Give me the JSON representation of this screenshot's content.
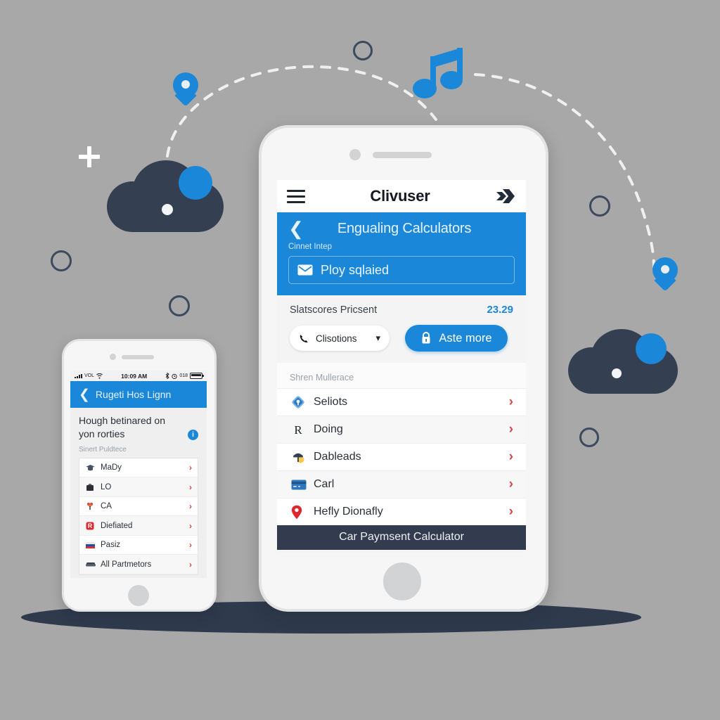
{
  "scene": {
    "background_color": "#a8a8a8",
    "accent_blue": "#1a87d8",
    "dark_navy": "#343f52",
    "chevron_red": "#d84545",
    "decorations": [
      {
        "name": "music-note-icon",
        "color": "#1a87d8"
      },
      {
        "name": "cloud-icon-left",
        "color": "#343f52"
      },
      {
        "name": "cloud-icon-right",
        "color": "#343f52"
      },
      {
        "name": "map-pin-icon-left",
        "color": "#1a87d8"
      },
      {
        "name": "map-pin-icon-right",
        "color": "#1a87d8"
      },
      {
        "name": "plus-icon",
        "color": "#ffffff"
      },
      {
        "name": "dashed-arc-left",
        "color": "#f0f0f0"
      },
      {
        "name": "dashed-arc-right",
        "color": "#f0f0f0"
      }
    ]
  },
  "big_phone": {
    "appbar": {
      "menu_icon": "hamburger-icon",
      "title": "Clivuser",
      "right_icon": "forward-arrow-icon"
    },
    "blue_header": {
      "back_icon": "chevron-left-icon",
      "title": "Engualing Calculators",
      "subtitle": "Cinnet Intep",
      "field": {
        "icon": "mail-icon",
        "value": "Ploy sqlaied"
      }
    },
    "stats": {
      "label": "Slatscores Pricsent",
      "value": "23.29",
      "dropdown": {
        "icon": "phone-icon",
        "label": "Clisotions",
        "caret": "chevron-down-icon"
      },
      "cta": {
        "icon": "lock-icon",
        "label": "Aste more"
      }
    },
    "list": {
      "caption": "Shren Mullerace",
      "items": [
        {
          "icon": "blue-badge-icon",
          "label": "Seliots",
          "chevron": "›"
        },
        {
          "icon": "letter-r-icon",
          "label": "Doing",
          "chevron": "›"
        },
        {
          "icon": "yellow-lamp-icon",
          "label": "Dableads",
          "chevron": "›"
        },
        {
          "icon": "credit-card-icon",
          "label": "Carl",
          "chevron": "›"
        },
        {
          "icon": "red-pin-icon",
          "label": "Hefly Dionafly",
          "chevron": "›"
        }
      ]
    },
    "footer": {
      "label": "Car Paymsent Calculator"
    }
  },
  "small_phone": {
    "status_bar": {
      "signal_icon": "signal-bars-icon",
      "carrier": "VOL",
      "wifi_icon": "wifi-icon",
      "time": "10:09 AM",
      "bluetooth_icon": "bluetooth-icon",
      "alarm_icon": "alarm-icon",
      "battery_percent": "018",
      "battery_icon": "battery-icon"
    },
    "blue_header": {
      "back_icon": "chevron-left-icon",
      "title": "Rugeti Hos Lignn"
    },
    "body": {
      "headline": "Hough betinared on yon rorties",
      "info_badge": "i",
      "subtitle": "Sinert Puldtece"
    },
    "list": {
      "items": [
        {
          "icon": "mortarboard-icon",
          "label": "MaDy",
          "chevron": "›"
        },
        {
          "icon": "bag-icon",
          "label": "LO",
          "chevron": "›"
        },
        {
          "icon": "bouquet-icon",
          "label": "CA",
          "chevron": "›"
        },
        {
          "icon": "red-square-icon",
          "label": "Diefiated",
          "chevron": "›"
        },
        {
          "icon": "flag-icon",
          "label": "Pasiz",
          "chevron": "›"
        },
        {
          "icon": "sofa-icon",
          "label": "All Partmetors",
          "chevron": "›"
        }
      ]
    }
  }
}
